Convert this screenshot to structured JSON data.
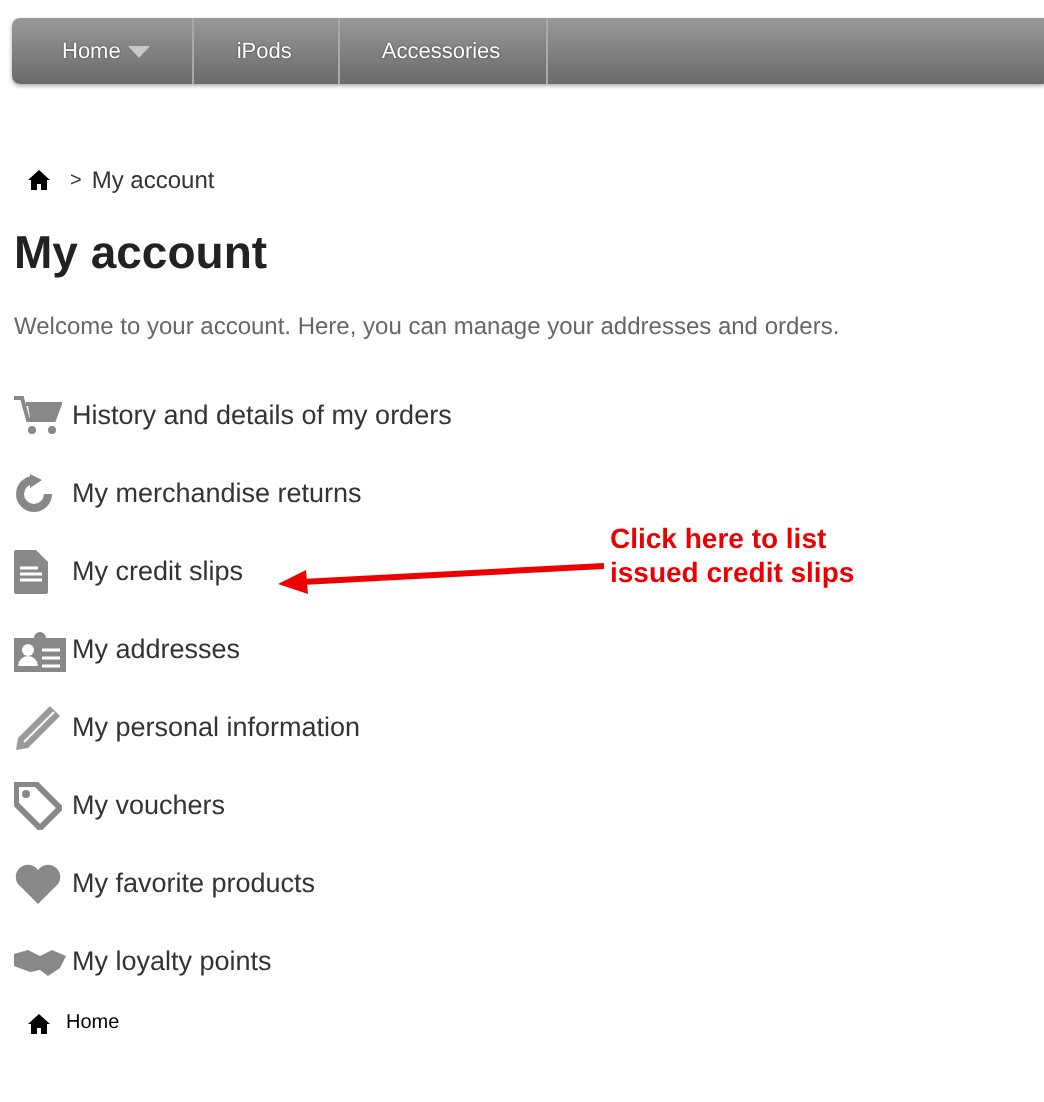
{
  "nav": {
    "items": [
      {
        "label": "Home",
        "has_dropdown": true
      },
      {
        "label": "iPods",
        "has_dropdown": false
      },
      {
        "label": "Accessories",
        "has_dropdown": false
      }
    ]
  },
  "breadcrumb": {
    "separator": ">",
    "current": "My account"
  },
  "title": "My account",
  "intro": "Welcome to your account. Here, you can manage your addresses and orders.",
  "links": [
    {
      "label": "History and details of my orders"
    },
    {
      "label": "My merchandise returns"
    },
    {
      "label": "My credit slips"
    },
    {
      "label": "My addresses"
    },
    {
      "label": "My personal information"
    },
    {
      "label": "My vouchers"
    },
    {
      "label": "My favorite products"
    },
    {
      "label": "My loyalty points"
    }
  ],
  "annotation": {
    "text": "Click here to list issued credit slips"
  },
  "footer": {
    "home": "Home"
  }
}
